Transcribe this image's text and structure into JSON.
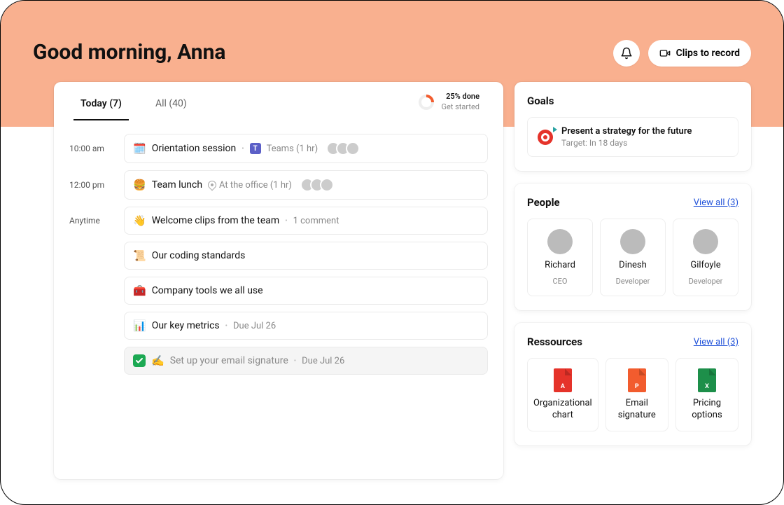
{
  "greeting": "Good morning, Anna",
  "actions": {
    "clips_label": "Clips to record"
  },
  "tabs": {
    "today": "Today (7)",
    "all": "All (40)"
  },
  "progress": {
    "percent_label": "25% done",
    "sub": "Get started"
  },
  "schedule": {
    "slot1_time": "10:00 am",
    "slot2_time": "12:00 pm",
    "slot3_time": "Anytime"
  },
  "tasks": [
    {
      "emoji": "🗓️",
      "title": "Orientation session",
      "meta": "Teams (1 hr)",
      "platform": "teams",
      "avatars": 3
    },
    {
      "emoji": "🍔",
      "title": "Team lunch",
      "meta": "At the office (1 hr)",
      "platform": "location",
      "avatars": 3
    },
    {
      "emoji": "👋",
      "title": "Welcome clips from the team",
      "meta": "1 comment"
    },
    {
      "emoji": "📜",
      "title": "Our coding standards"
    },
    {
      "emoji": "🧰",
      "title": "Company tools we all use"
    },
    {
      "emoji": "📊",
      "title": "Our key metrics",
      "meta": "Due Jul 26"
    },
    {
      "emoji": "✍️",
      "title": "Set up your email signature",
      "meta": "Due Jul 26",
      "done": true
    }
  ],
  "goals": {
    "title": "Goals",
    "item_title": "Present a strategy for the future",
    "item_sub": "Target: In 18 days"
  },
  "people": {
    "title": "People",
    "view_all": "View all (3)",
    "items": [
      {
        "name": "Richard",
        "role": "CEO"
      },
      {
        "name": "Dinesh",
        "role": "Developer"
      },
      {
        "name": "Gilfoyle",
        "role": "Developer"
      }
    ]
  },
  "resources": {
    "title": "Ressources",
    "view_all": "View all (3)",
    "items": [
      {
        "name": "Organizational chart",
        "type": "pdf",
        "letter": "A"
      },
      {
        "name": "Email signature",
        "type": "ppt",
        "letter": "P"
      },
      {
        "name": "Pricing options",
        "type": "xls",
        "letter": "X"
      }
    ]
  }
}
